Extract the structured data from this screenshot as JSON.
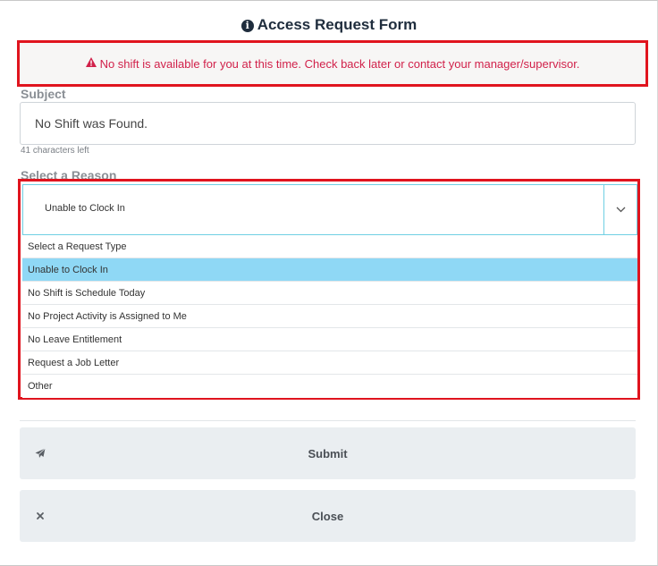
{
  "dialog": {
    "title": "Access Request Form",
    "title_icon": "info-circle-icon"
  },
  "alert": {
    "icon": "warning-triangle-icon",
    "message": "No shift is available for you at this time. Check back later or contact your manager/supervisor.",
    "color": "#d1214a",
    "border_color": "#e0141e"
  },
  "subject": {
    "label": "Subject",
    "value": "No Shift was Found.",
    "counter": "41 characters left"
  },
  "reason": {
    "label": "Select a Reason",
    "selected": "Unable to Clock In",
    "options": [
      "Select a Request Type",
      "Unable to Clock In",
      "No Shift is Schedule Today",
      "No Project Activity is Assigned to Me",
      "No Leave Entitlement",
      "Request a Job Letter",
      "Other"
    ],
    "selected_index": 1,
    "highlight_color": "#8fd8f5"
  },
  "buttons": {
    "submit_label": "Submit",
    "submit_icon": "paper-plane-icon",
    "close_label": "Close",
    "close_icon": "close-icon"
  }
}
